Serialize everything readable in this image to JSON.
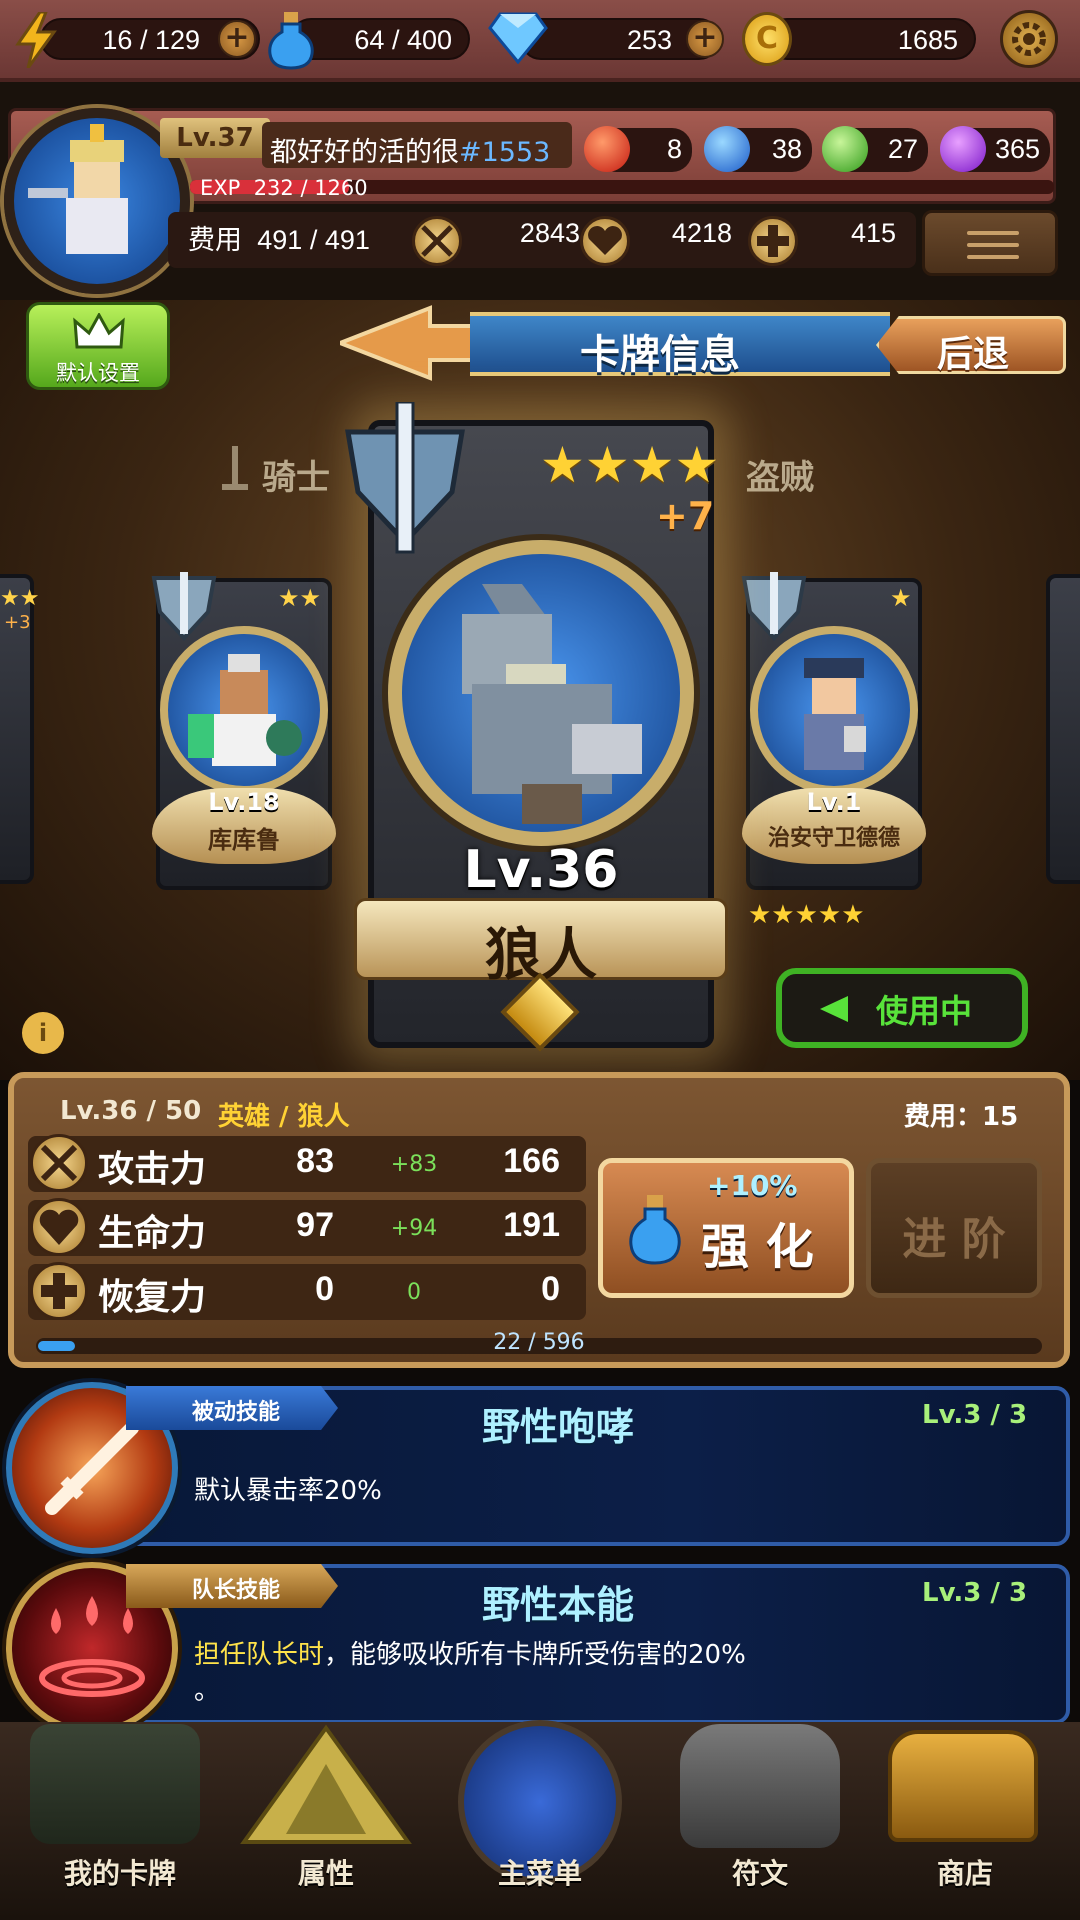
{
  "top_bar": {
    "energy": "16 / 129",
    "potion": "64 / 400",
    "gems": "253",
    "gold": "1685"
  },
  "profile": {
    "level": "Lv.37",
    "name": "都好好的活的很",
    "id": "#1553",
    "exp_label": "EXP",
    "exp_value": "232 / 1260",
    "exp_fraction": 0.184,
    "orbs": {
      "red": "8",
      "blue": "38",
      "green": "27",
      "purple": "365"
    },
    "cost_label": "费用",
    "cost_value": "491 / 491",
    "attack": "2843",
    "hp": "4218",
    "recovery": "415"
  },
  "default_button": "默认设置",
  "header": {
    "title": "卡牌信息",
    "back": "后退"
  },
  "cards": {
    "left_tab": "骑士",
    "right_tab": "盗贼",
    "left": {
      "level": "Lv.18",
      "name": "库库鲁",
      "stars": "★★"
    },
    "right": {
      "level": "Lv.1",
      "name": "治安守卫德德",
      "stars": "★"
    },
    "far_left_plus": "+3",
    "main": {
      "level": "Lv.36",
      "name": "狼人",
      "stars": "★★★★",
      "plus": "+7"
    },
    "in_use": "使用中"
  },
  "stats": {
    "level": "Lv.36 / 50",
    "type": "英雄 / 狼人",
    "cost": "费用：15",
    "rows": [
      {
        "label": "攻击力",
        "base": "83",
        "bonus": "+83",
        "total": "166"
      },
      {
        "label": "生命力",
        "base": "97",
        "bonus": "+94",
        "total": "191"
      },
      {
        "label": "恢复力",
        "base": "0",
        "bonus": "0",
        "total": "0"
      }
    ],
    "enhance_bonus": "+10%",
    "enhance": "强 化",
    "advance": "进 阶",
    "progress": "22 / 596",
    "progress_fraction": 0.037
  },
  "skills": [
    {
      "tag": "被动技能",
      "name": "野性咆哮",
      "level": "Lv.3 / 3",
      "desc": "默认暴击率20%"
    },
    {
      "tag": "队长技能",
      "name": "野性本能",
      "level": "Lv.3 / 3",
      "desc_highlight": "担任队长时",
      "desc": "，能够吸收所有卡牌所受伤害的20%",
      "desc_line2": "。"
    }
  ],
  "nav": [
    "我的卡牌",
    "属性",
    "主菜单",
    "符文",
    "商店"
  ]
}
